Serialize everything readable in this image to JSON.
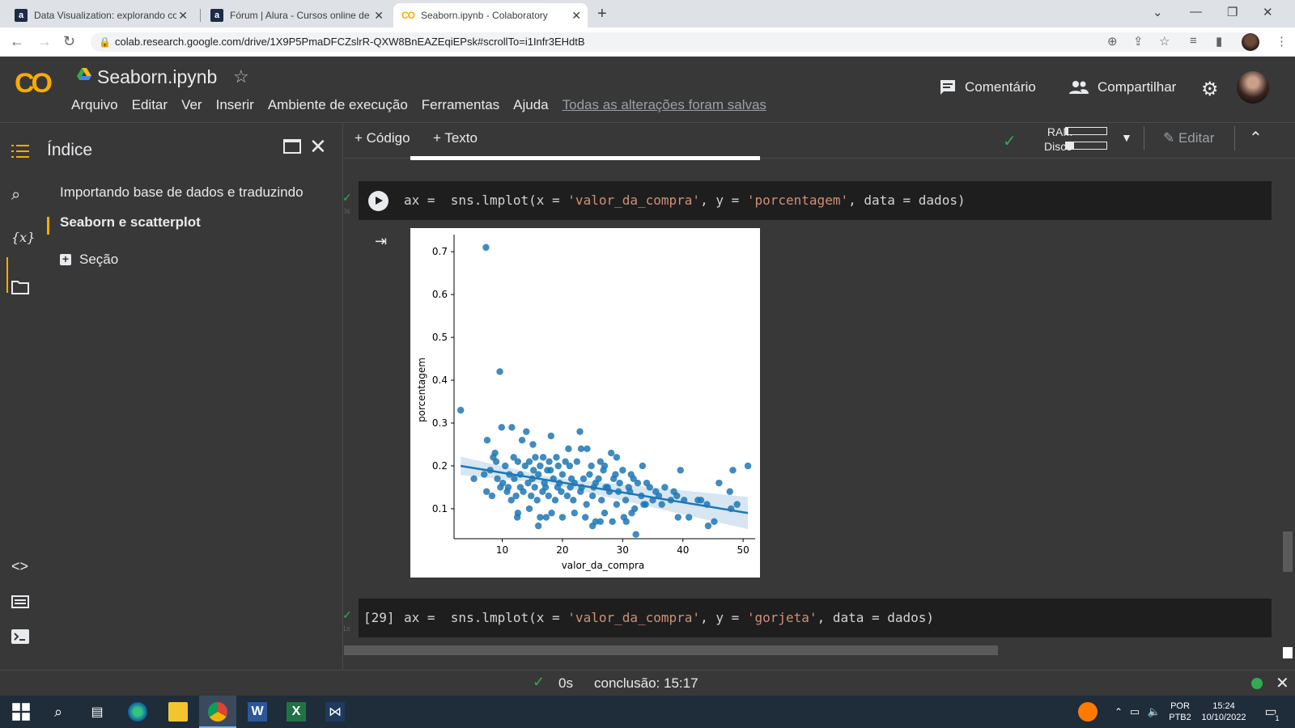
{
  "browser": {
    "tabs": [
      {
        "title": "Data Visualization: explorando co",
        "favicon": "a"
      },
      {
        "title": "Fórum | Alura - Cursos online de",
        "favicon": "a"
      },
      {
        "title": "Seaborn.ipynb - Colaboratory",
        "favicon": "CO"
      }
    ],
    "url": "colab.research.google.com/drive/1X9P5PmaDFCZslrR-QXW8BnEAZEqiEPsk#scrollTo=i1Infr3EHdtB"
  },
  "header": {
    "logo": "CO",
    "notebook_title": "Seaborn.ipynb",
    "menu": [
      "Arquivo",
      "Editar",
      "Ver",
      "Inserir",
      "Ambiente de execução",
      "Ferramentas",
      "Ajuda"
    ],
    "saved_status": "Todas as alterações foram salvas",
    "comment": "Comentário",
    "share": "Compartilhar"
  },
  "toc": {
    "title": "Índice",
    "items": [
      "Importando base de dados e traduzindo",
      "Seaborn e scatterplot"
    ],
    "section": "Seção"
  },
  "toolbar": {
    "add_code": "+ Código",
    "add_text": "+ Texto",
    "ram": "RAM",
    "disk": "Disco",
    "ram_usage": 0.05,
    "disk_usage": 0.2,
    "edit": "Editar"
  },
  "cells": [
    {
      "code_prefix": "ax =  sns.lmplot(x = ",
      "x": "'valor_da_compra'",
      "mid": ", y = ",
      "y": "'porcentagem'",
      "suffix": ", data = dados)",
      "status": "0s"
    },
    {
      "exec_count": "[29]",
      "code_prefix": "ax =  sns.lmplot(x = ",
      "x": "'valor_da_compra'",
      "mid": ", y = ",
      "y": "'gorjeta'",
      "suffix": ", data = dados)",
      "status": "1s"
    }
  ],
  "chart_data": {
    "type": "scatter",
    "xlabel": "valor_da_compra",
    "ylabel": "porcentagem",
    "xticks": [
      10,
      20,
      30,
      40,
      50
    ],
    "yticks": [
      0.1,
      0.2,
      0.3,
      0.4,
      0.5,
      0.6,
      0.7
    ],
    "xlim": [
      2,
      52
    ],
    "ylim": [
      0.03,
      0.74
    ],
    "point_color": "#1f77b4",
    "regression_line": {
      "x": [
        3.1,
        50.8
      ],
      "y": [
        0.2,
        0.09
      ]
    },
    "points": [
      [
        7.3,
        0.71
      ],
      [
        9.6,
        0.42
      ],
      [
        3.1,
        0.33
      ],
      [
        9.9,
        0.29
      ],
      [
        11.6,
        0.29
      ],
      [
        14.0,
        0.28
      ],
      [
        22.9,
        0.28
      ],
      [
        7.5,
        0.26
      ],
      [
        13.3,
        0.26
      ],
      [
        15.1,
        0.25
      ],
      [
        18.1,
        0.27
      ],
      [
        21.0,
        0.24
      ],
      [
        23.1,
        0.24
      ],
      [
        24.1,
        0.24
      ],
      [
        28.1,
        0.23
      ],
      [
        8.5,
        0.22
      ],
      [
        8.8,
        0.23
      ],
      [
        11.9,
        0.22
      ],
      [
        12.6,
        0.21
      ],
      [
        14.5,
        0.21
      ],
      [
        15.5,
        0.22
      ],
      [
        16.3,
        0.2
      ],
      [
        17.8,
        0.21
      ],
      [
        19.0,
        0.22
      ],
      [
        20.5,
        0.21
      ],
      [
        21.2,
        0.2
      ],
      [
        22.4,
        0.21
      ],
      [
        26.3,
        0.21
      ],
      [
        27.0,
        0.2
      ],
      [
        29.0,
        0.22
      ],
      [
        30.0,
        0.19
      ],
      [
        31.4,
        0.18
      ],
      [
        33.3,
        0.2
      ],
      [
        39.6,
        0.19
      ],
      [
        48.3,
        0.19
      ],
      [
        50.8,
        0.2
      ],
      [
        47.8,
        0.14
      ],
      [
        5.3,
        0.17
      ],
      [
        7.0,
        0.18
      ],
      [
        8.0,
        0.19
      ],
      [
        9.2,
        0.17
      ],
      [
        10.1,
        0.16
      ],
      [
        11.2,
        0.18
      ],
      [
        12.0,
        0.17
      ],
      [
        13.0,
        0.18
      ],
      [
        14.3,
        0.16
      ],
      [
        15.0,
        0.17
      ],
      [
        16.0,
        0.18
      ],
      [
        17.0,
        0.16
      ],
      [
        17.5,
        0.19
      ],
      [
        18.5,
        0.17
      ],
      [
        19.5,
        0.16
      ],
      [
        20.0,
        0.18
      ],
      [
        21.5,
        0.17
      ],
      [
        22.0,
        0.16
      ],
      [
        23.5,
        0.17
      ],
      [
        24.5,
        0.18
      ],
      [
        25.5,
        0.16
      ],
      [
        26.0,
        0.17
      ],
      [
        27.5,
        0.15
      ],
      [
        28.5,
        0.17
      ],
      [
        29.5,
        0.16
      ],
      [
        31.0,
        0.15
      ],
      [
        32.5,
        0.16
      ],
      [
        34.5,
        0.15
      ],
      [
        35.5,
        0.14
      ],
      [
        7.4,
        0.14
      ],
      [
        8.3,
        0.13
      ],
      [
        9.7,
        0.15
      ],
      [
        10.8,
        0.14
      ],
      [
        11.5,
        0.12
      ],
      [
        12.3,
        0.13
      ],
      [
        13.5,
        0.14
      ],
      [
        14.8,
        0.13
      ],
      [
        15.8,
        0.12
      ],
      [
        16.7,
        0.14
      ],
      [
        17.7,
        0.13
      ],
      [
        18.8,
        0.12
      ],
      [
        19.8,
        0.14
      ],
      [
        20.8,
        0.13
      ],
      [
        21.8,
        0.12
      ],
      [
        23.0,
        0.14
      ],
      [
        24.0,
        0.11
      ],
      [
        25.0,
        0.13
      ],
      [
        26.5,
        0.12
      ],
      [
        27.8,
        0.14
      ],
      [
        29.0,
        0.11
      ],
      [
        30.5,
        0.12
      ],
      [
        32.0,
        0.1
      ],
      [
        33.5,
        0.11
      ],
      [
        35.0,
        0.12
      ],
      [
        36.5,
        0.11
      ],
      [
        38.0,
        0.12
      ],
      [
        40.2,
        0.12
      ],
      [
        42.5,
        0.12
      ],
      [
        44.0,
        0.11
      ],
      [
        12.6,
        0.09
      ],
      [
        14.5,
        0.1
      ],
      [
        16.3,
        0.08
      ],
      [
        18.2,
        0.09
      ],
      [
        20.0,
        0.08
      ],
      [
        22.0,
        0.09
      ],
      [
        23.8,
        0.08
      ],
      [
        25.5,
        0.07
      ],
      [
        27.0,
        0.09
      ],
      [
        28.3,
        0.07
      ],
      [
        30.2,
        0.08
      ],
      [
        31.5,
        0.09
      ],
      [
        33.8,
        0.11
      ],
      [
        39.2,
        0.08
      ],
      [
        41.0,
        0.08
      ],
      [
        45.2,
        0.07
      ],
      [
        12.5,
        0.08
      ],
      [
        16.0,
        0.06
      ],
      [
        17.3,
        0.08
      ],
      [
        25.0,
        0.06
      ],
      [
        26.3,
        0.07
      ],
      [
        30.6,
        0.07
      ],
      [
        32.2,
        0.04
      ],
      [
        44.2,
        0.06
      ],
      [
        13.8,
        0.2
      ],
      [
        15.2,
        0.19
      ],
      [
        16.8,
        0.22
      ],
      [
        18.0,
        0.19
      ],
      [
        10.5,
        0.2
      ],
      [
        9.0,
        0.21
      ],
      [
        19.3,
        0.2
      ],
      [
        24.8,
        0.2
      ],
      [
        26.8,
        0.19
      ],
      [
        28.8,
        0.18
      ],
      [
        31.8,
        0.17
      ],
      [
        34.0,
        0.16
      ],
      [
        37.0,
        0.15
      ],
      [
        39.0,
        0.13
      ],
      [
        43.0,
        0.12
      ],
      [
        49.0,
        0.11
      ],
      [
        48.0,
        0.1
      ],
      [
        11.0,
        0.15
      ],
      [
        13.0,
        0.15
      ],
      [
        15.4,
        0.15
      ],
      [
        17.2,
        0.15
      ],
      [
        19.2,
        0.15
      ],
      [
        21.3,
        0.15
      ],
      [
        23.2,
        0.15
      ],
      [
        25.2,
        0.15
      ],
      [
        27.2,
        0.15
      ],
      [
        29.3,
        0.14
      ],
      [
        31.2,
        0.14
      ],
      [
        33.1,
        0.13
      ],
      [
        36.0,
        0.13
      ],
      [
        38.5,
        0.14
      ],
      [
        46.0,
        0.16
      ]
    ]
  },
  "statusbar": {
    "time": "0s",
    "completion": "conclusão: 15:17"
  },
  "taskbar": {
    "lang_top": "POR",
    "lang_bottom": "PTB2",
    "clock_time": "15:24",
    "clock_date": "10/10/2022",
    "notifications": "1"
  }
}
